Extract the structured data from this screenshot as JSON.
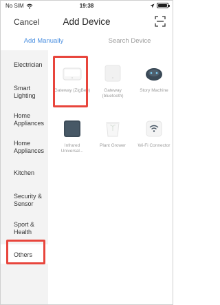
{
  "status_bar": {
    "carrier": "No SIM",
    "time": "19:38"
  },
  "nav": {
    "cancel_label": "Cancel",
    "title": "Add Device"
  },
  "tabs": [
    {
      "label": "Add Manually",
      "active": true
    },
    {
      "label": "Search Device",
      "active": false
    }
  ],
  "sidebar": {
    "items": [
      {
        "label": "Electrician"
      },
      {
        "label": "Smart Lighting"
      },
      {
        "label": "Home Appliances"
      },
      {
        "label": "Home Appliances"
      },
      {
        "label": "Kitchen"
      },
      {
        "label": "Security & Sensor"
      },
      {
        "label": "Sport & Health"
      },
      {
        "label": "Others"
      }
    ],
    "selected": "Others"
  },
  "devices": [
    {
      "label": "Gateway (ZigBee)",
      "icon": "zigbee-gateway-icon"
    },
    {
      "label": "Gateway (bluetooth)",
      "icon": "bluetooth-gateway-icon"
    },
    {
      "label": "Story Machine",
      "icon": "story-machine-icon"
    },
    {
      "label": "Infrared Universal...",
      "icon": "infrared-remote-icon"
    },
    {
      "label": "Plant Grower",
      "icon": "plant-grower-icon"
    },
    {
      "label": "Wi-Fi Connector",
      "icon": "wifi-connector-icon"
    }
  ],
  "colors": {
    "accent": "#4a8fe0",
    "highlight": "#e8453c",
    "sidebar_bg": "#f3f3f3"
  }
}
